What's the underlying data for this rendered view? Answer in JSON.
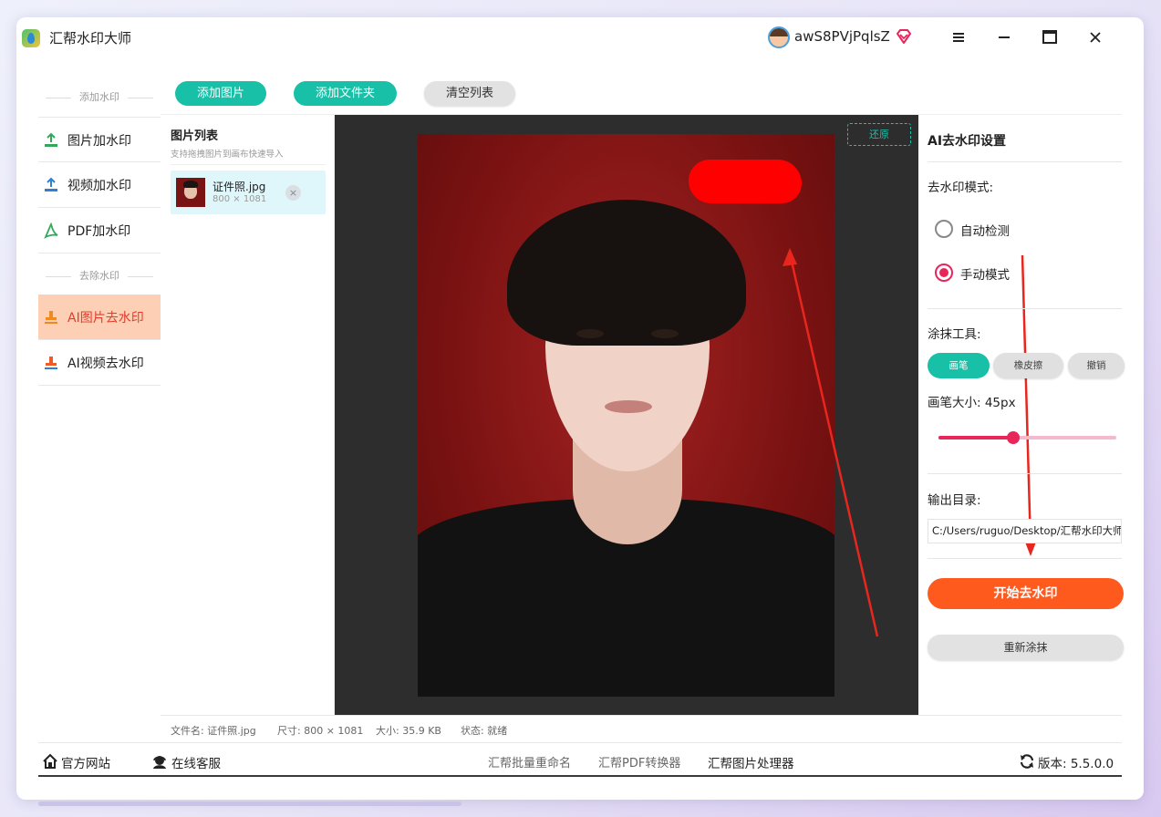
{
  "app": {
    "title": "汇帮水印大师"
  },
  "user": {
    "name": "awS8PVjPqlsZ"
  },
  "sidebar": {
    "section_add": "添加水印",
    "section_remove": "去除水印",
    "items": [
      {
        "label": "图片加水印",
        "icon": "image-upload-icon"
      },
      {
        "label": "视频加水印",
        "icon": "video-upload-icon"
      },
      {
        "label": "PDF加水印",
        "icon": "pdf-icon"
      },
      {
        "label": "AI图片去水印",
        "icon": "stamp-icon",
        "active": true
      },
      {
        "label": "AI视频去水印",
        "icon": "stamp-icon"
      }
    ]
  },
  "toolbar": {
    "add_image": "添加图片",
    "add_folder": "添加文件夹",
    "clear_list": "清空列表"
  },
  "image_list": {
    "title": "图片列表",
    "hint": "支持拖拽图片到画布快速导入",
    "items": [
      {
        "name": "证件照.jpg",
        "dims": "800 × 1081",
        "remove": "×"
      }
    ]
  },
  "canvas": {
    "restore_label": "还原"
  },
  "settings": {
    "title": "AI去水印设置",
    "mode_label": "去水印模式:",
    "modes": [
      {
        "label": "自动检测",
        "checked": false
      },
      {
        "label": "手动模式",
        "checked": true
      }
    ],
    "tool_label": "涂抹工具:",
    "tools": [
      {
        "label": "画笔",
        "active": true
      },
      {
        "label": "橡皮擦",
        "active": false
      },
      {
        "label": "撤销",
        "active": false
      }
    ],
    "brush_size_label": "画笔大小:  45px",
    "brush_size_fraction": 0.42,
    "output_label": "输出目录:",
    "output_path": "C:/Users/ruguo/Desktop/汇帮水印大师",
    "start_button": "开始去水印",
    "redo_button": "重新涂抹"
  },
  "status": {
    "filename": "文件名: 证件照.jpg",
    "size": "尺寸: 800 × 1081",
    "filesize": "大小: 35.9 KB",
    "state": "状态: 就绪"
  },
  "footer": {
    "website": "官方网站",
    "support": "在线客服",
    "batch_rename": "汇帮批量重命名",
    "pdf_converter": "汇帮PDF转换器",
    "image_processor": "汇帮图片处理器",
    "version": "版本: 5.5.0.0"
  },
  "colors": {
    "accent_teal": "#17c0a6",
    "accent_pink": "#e8265a",
    "start_orange": "#fe5a1e",
    "active_nav_bg": "#fdd0b5",
    "active_nav_text": "#e63a2c",
    "brush_red": "#ff0000"
  }
}
